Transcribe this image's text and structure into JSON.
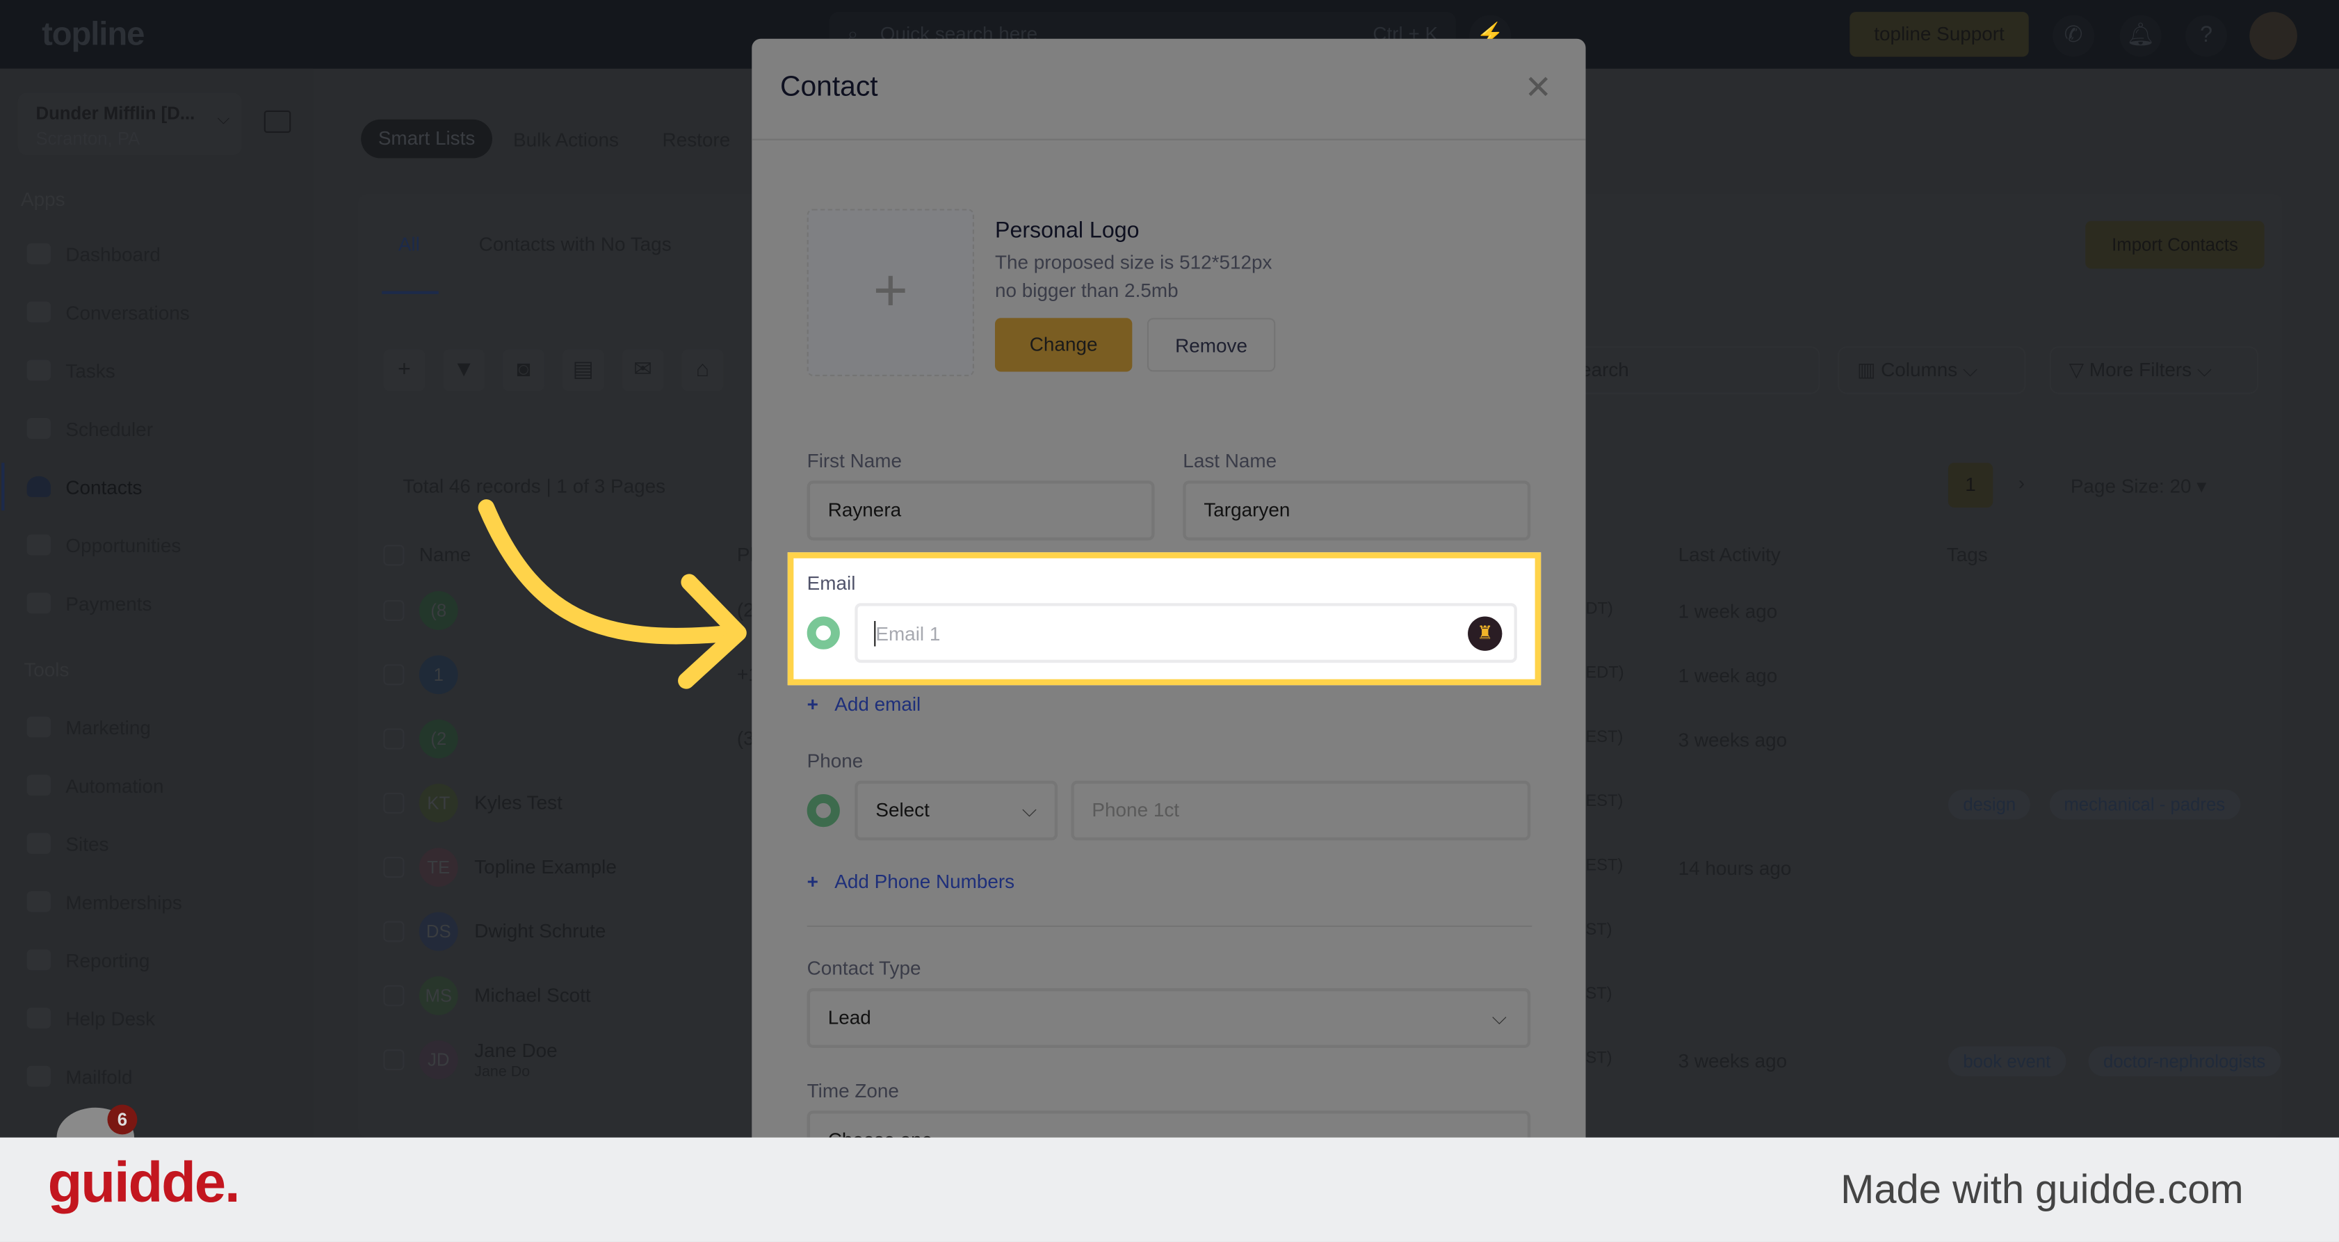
{
  "topbar": {
    "logo": "topline",
    "search_placeholder": "Quick search here",
    "search_shortcut": "Ctrl + K",
    "support_button": "topline Support"
  },
  "sidebar": {
    "company_name": "Dunder Mifflin [D...",
    "company_location": "Scranton, PA",
    "apps_heading": "Apps",
    "tools_heading": "Tools",
    "apps": [
      {
        "label": "Dashboard"
      },
      {
        "label": "Conversations"
      },
      {
        "label": "Tasks"
      },
      {
        "label": "Scheduler"
      },
      {
        "label": "Contacts",
        "active": true
      },
      {
        "label": "Opportunities"
      },
      {
        "label": "Payments"
      }
    ],
    "tools": [
      {
        "label": "Marketing"
      },
      {
        "label": "Automation"
      },
      {
        "label": "Sites"
      },
      {
        "label": "Memberships"
      },
      {
        "label": "Reporting"
      },
      {
        "label": "Help Desk"
      },
      {
        "label": "Mailfold"
      }
    ],
    "chat_badge": "6"
  },
  "main": {
    "top_tabs": [
      "Smart Lists",
      "Bulk Actions",
      "Restore"
    ],
    "list_tabs": [
      "All",
      "Contacts with No Tags"
    ],
    "import_button": "Import Contacts",
    "search_placeholder": "search",
    "columns_button": "Columns",
    "more_filters_button": "More Filters",
    "records_summary": "Total 46 records | 1 of 3 Pages",
    "current_page": "1",
    "page_size": "Page Size: 20",
    "headers": {
      "name": "Name",
      "phone": "Pl",
      "last_activity": "Last Activity",
      "tags": "Tags"
    },
    "rows": [
      {
        "initials": "(8",
        "name": "",
        "sub": "",
        "phone": "(2",
        "tz": "DT)",
        "activity": "1 week ago",
        "tags": [],
        "color": "#23372b"
      },
      {
        "initials": "1",
        "name": "",
        "sub": "",
        "phone": "+1",
        "tz": "EDT)",
        "activity": "1 week ago",
        "tags": [],
        "color": "#1f2a38"
      },
      {
        "initials": "(2",
        "name": "",
        "sub": "",
        "phone": "(3",
        "tz": "EST)",
        "activity": "3 weeks ago",
        "tags": [],
        "color": "#23372b"
      },
      {
        "initials": "KT",
        "name": "Kyles Test",
        "sub": "",
        "phone": "",
        "tz": "EST)",
        "activity": "",
        "tags": [
          "design",
          "mechanical - padres"
        ],
        "color": "#2c3326"
      },
      {
        "initials": "TE",
        "name": "Topline Example",
        "sub": "",
        "phone": "",
        "tz": "EST)",
        "activity": "14 hours ago",
        "tags": [],
        "color": "#352a30"
      },
      {
        "initials": "DS",
        "name": "Dwight Schrute",
        "sub": "",
        "phone": "",
        "tz": "ST)",
        "activity": "",
        "tags": [],
        "color": "#232a3a"
      },
      {
        "initials": "MS",
        "name": "Michael Scott",
        "sub": "",
        "phone": "",
        "tz": "ST)",
        "activity": "",
        "tags": [],
        "color": "#28362b"
      },
      {
        "initials": "JD",
        "name": "Jane Doe",
        "sub": "Jane Do",
        "phone": "",
        "tz": "ST)",
        "activity": "3 weeks ago",
        "tags": [
          "book event",
          "doctor-nephrologists"
        ],
        "color": "#302a33"
      }
    ]
  },
  "modal": {
    "title": "Contact",
    "logo_title": "Personal Logo",
    "logo_hint1": "The proposed size is 512*512px",
    "logo_hint2": "no bigger than 2.5mb",
    "change_button": "Change",
    "remove_button": "Remove",
    "first_name_label": "First Name",
    "first_name_value": "Raynera",
    "last_name_label": "Last Name",
    "last_name_value": "Targaryen",
    "email_label": "Email",
    "email_placeholder": "Email 1",
    "add_email": "Add email",
    "phone_label": "Phone",
    "phone_type": "Select",
    "phone_placeholder": "Phone 1ct",
    "add_phone": "Add Phone Numbers",
    "contact_type_label": "Contact Type",
    "contact_type_value": "Lead",
    "time_zone_label": "Time Zone",
    "time_zone_value": "Choose one"
  },
  "footer": {
    "brand": "guidde.",
    "made_with": "Made with guidde.com"
  },
  "colors": {
    "highlight": "#ffd34a",
    "accent": "#e0b32a",
    "brand_red": "#c3161f"
  }
}
